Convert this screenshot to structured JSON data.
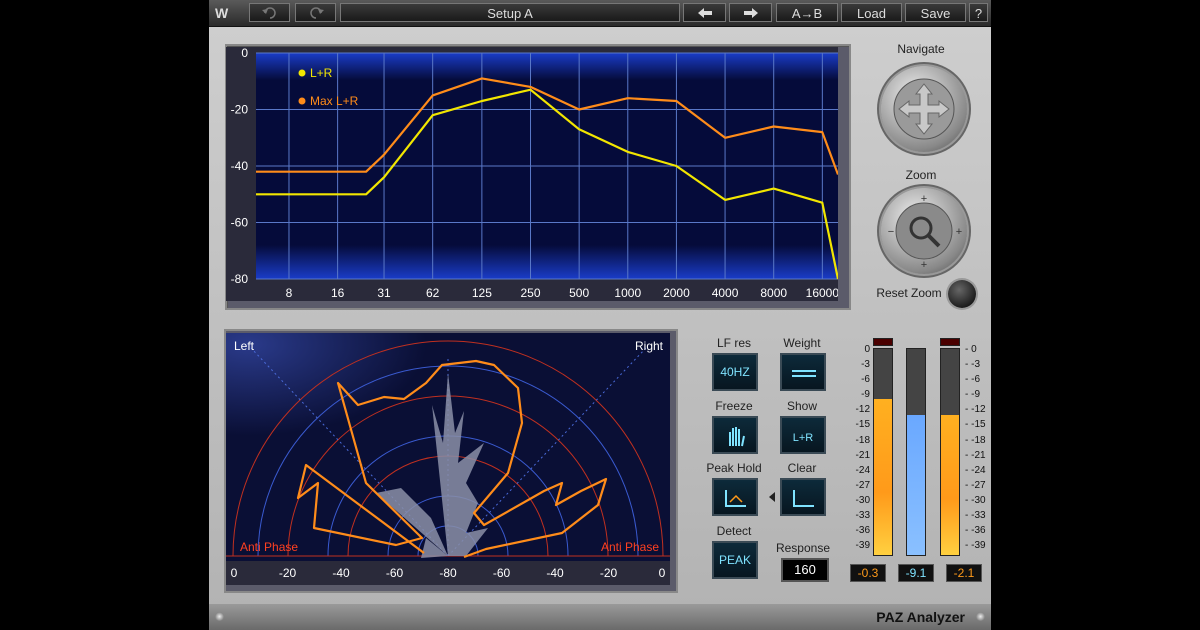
{
  "toolbar": {
    "logo": "W",
    "undo_icon": "undo-icon",
    "redo_icon": "redo-icon",
    "preset_name": "Setup A",
    "prev_icon": "arrow-left-icon",
    "next_icon": "arrow-right-icon",
    "ab_label": "A→B",
    "load_label": "Load",
    "save_label": "Save",
    "help_label": "?"
  },
  "spectrum": {
    "legend": [
      {
        "label": "L+R",
        "color": "#f2e600"
      },
      {
        "label": "Max L+R",
        "color": "#ff8c1a"
      }
    ],
    "y_ticks": [
      "0",
      "-20",
      "-40",
      "-60",
      "-80"
    ],
    "x_ticks": [
      "8",
      "16",
      "31",
      "62",
      "125",
      "250",
      "500",
      "1000",
      "2000",
      "4000",
      "8000",
      "16000"
    ],
    "chart_data": {
      "type": "line",
      "x": [
        5,
        8,
        16,
        24,
        31,
        62,
        125,
        250,
        500,
        1000,
        2000,
        4000,
        8000,
        16000,
        20000
      ],
      "ylim": [
        -80,
        0
      ],
      "series": [
        {
          "name": "L+R",
          "values": [
            -50,
            -50,
            -50,
            -50,
            -44,
            -22,
            -17,
            -13,
            -27,
            -35,
            -40,
            -52,
            -48,
            -53,
            -80
          ]
        },
        {
          "name": "Max L+R",
          "values": [
            -42,
            -42,
            -42,
            -42,
            -36,
            -15,
            -9,
            -12,
            -20,
            -16,
            -17,
            -30,
            -26,
            -28,
            -43
          ]
        }
      ]
    }
  },
  "navigate": {
    "title": "Navigate"
  },
  "zoom": {
    "title": "Zoom",
    "reset_label": "Reset Zoom"
  },
  "stereo": {
    "left_label": "Left",
    "right_label": "Right",
    "antiphase_left": "Anti Phase",
    "antiphase_right": "Anti Phase",
    "scale": [
      "0",
      "-20",
      "-40",
      "-60",
      "-80",
      "-60",
      "-40",
      "-20",
      "0"
    ]
  },
  "controls": {
    "lf_res": {
      "title": "LF res",
      "value": "40HZ"
    },
    "weight": {
      "title": "Weight",
      "icon": "flat-weight-icon"
    },
    "freeze": {
      "title": "Freeze",
      "icon": "hand-icon"
    },
    "show": {
      "title": "Show",
      "value": "L+R"
    },
    "peak_hold": {
      "title": "Peak Hold",
      "icon": "peak-hold-icon"
    },
    "clear": {
      "title": "Clear",
      "icon": "clear-icon"
    },
    "detect": {
      "title": "Detect",
      "value": "PEAK"
    },
    "response": {
      "title": "Response",
      "value": "160"
    }
  },
  "meters": {
    "scale": [
      "0",
      "-3",
      "-6",
      "-9",
      "-12",
      "-15",
      "-18",
      "-21",
      "-24",
      "-27",
      "-30",
      "-33",
      "-36",
      "-39"
    ],
    "left": {
      "value": "-0.3",
      "color": "#ff9a1a",
      "level_db": -9.5
    },
    "mid": {
      "value": "-9.1",
      "color": "#6aa8ff",
      "level_db": -12.5
    },
    "right": {
      "value": "-2.1",
      "color": "#ff9a1a",
      "level_db": -12.5
    }
  },
  "footer": {
    "product": "PAZ Analyzer"
  }
}
